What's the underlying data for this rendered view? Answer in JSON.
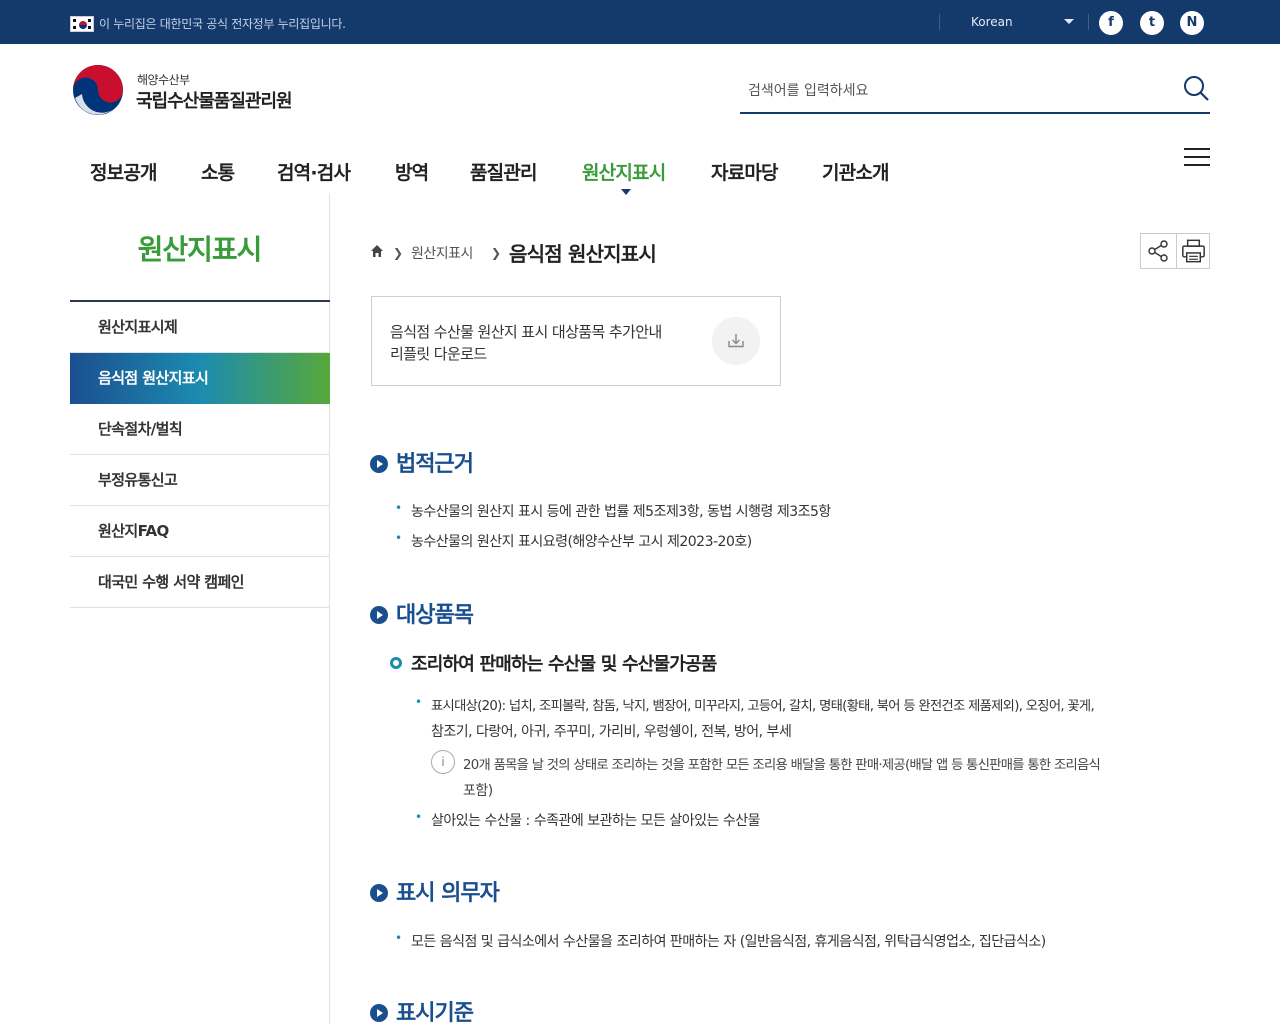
{
  "govbar": {
    "notice": "이 누리집은 대한민국 공식 전자정부 누리집입니다.",
    "language": "Korean",
    "sns": [
      "f",
      "t",
      "N"
    ]
  },
  "header": {
    "org_sub": "해양수산부",
    "org_title": "국립수산물품질관리원",
    "search_placeholder": "검색어를 입력하세요"
  },
  "gnb": {
    "items": [
      "정보공개",
      "소통",
      "검역·검사",
      "방역",
      "품질관리",
      "원산지표시",
      "자료마당",
      "기관소개"
    ],
    "active_index": 5
  },
  "sidebar": {
    "title": "원산지표시",
    "items": [
      "원산지표시제",
      "음식점 원산지표시",
      "단속절차/벌칙",
      "부정유통신고",
      "원산지FAQ",
      "대국민 수행 서약 캠페인"
    ],
    "active_index": 1
  },
  "breadcrumb": {
    "parent": "원산지표시",
    "current": "음식점 원산지표시"
  },
  "download": {
    "line1": "음식점 수산물 원산지 표시 대상품목 추가안내",
    "line2": "리플릿 다운로드"
  },
  "sections": {
    "legal": {
      "title": "법적근거",
      "items": [
        "농수산물의 원산지 표시 등에 관한 법률 제5조제3항, 동법 시행령 제3조5항",
        "농수산물의 원산지 표시요령(해양수산부 고시 제2023-20호)"
      ]
    },
    "target": {
      "title": "대상품목",
      "subtitle": "조리하여 판매하는 수산물 및 수산물가공품",
      "item1_line1": "표시대상(20): 넙치, 조피볼락, 참돔, 낙지, 뱀장어, 미꾸라지, 고등어, 갈치, 명태(황태, 북어 등 완전건조 제품제외), 오징어, 꽃게,",
      "item1_line2": "참조기, 다랑어, 아귀, 주꾸미, 가리비, 우렁쉥이, 전복, 방어, 부세",
      "note_line1": "20개 품목을 날 것의 상태로 조리하는 것을 포함한 모든 조리용 배달을 통한 판매·제공(배달 앱 등 통신판매를 통한 조리음식",
      "note_line2": "포함)",
      "item2": "살아있는 수산물 : 수족관에 보관하는 모든 살아있는 수산물"
    },
    "duty": {
      "title": "표시 의무자",
      "items": [
        "모든 음식점 및 급식소에서 수산물을 조리하여 판매하는 자 (일반음식점, 휴게음식점, 위탁급식영업소, 집단급식소)"
      ]
    },
    "standard": {
      "title": "표시기준"
    }
  },
  "colors": {
    "govbar": "#143a6b",
    "accent_green": "#3a9b3a",
    "section_blue": "#1a4f8f"
  }
}
